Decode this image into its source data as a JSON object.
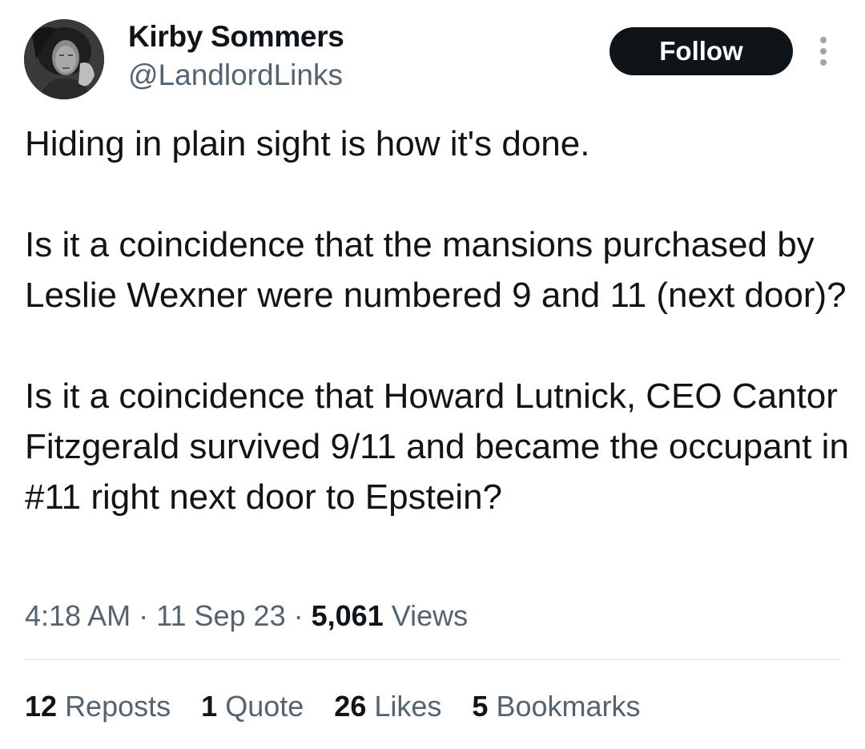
{
  "author": {
    "display_name": "Kirby Sommers",
    "handle": "@LandlordLinks",
    "avatar_icon": "profile-photo"
  },
  "follow_button": {
    "label": "Follow"
  },
  "more_menu": {
    "icon": "more-vertical-icon"
  },
  "tweet": {
    "paragraphs": [
      "Hiding in plain sight is how it's done.",
      "Is it a coincidence that the mansions purchased by Leslie Wexner were numbered 9 and 11 (next door)?",
      "Is it a coincidence that Howard Lutnick, CEO Cantor Fitzgerald survived 9/11 and became the occupant in #11 right next door to Epstein?"
    ]
  },
  "meta": {
    "time": "4:18 AM",
    "separator": "·",
    "date": "11 Sep 23",
    "views_count": "5,061",
    "views_label": "Views"
  },
  "stats": {
    "reposts_count": "12",
    "reposts_label": "Reposts",
    "quotes_count": "1",
    "quotes_label": "Quote",
    "likes_count": "26",
    "likes_label": "Likes",
    "bookmarks_count": "5",
    "bookmarks_label": "Bookmarks"
  },
  "colors": {
    "text_primary": "#0f1419",
    "text_secondary": "#536471",
    "button_bg": "#0f1419",
    "divider": "#e3e7ea"
  }
}
